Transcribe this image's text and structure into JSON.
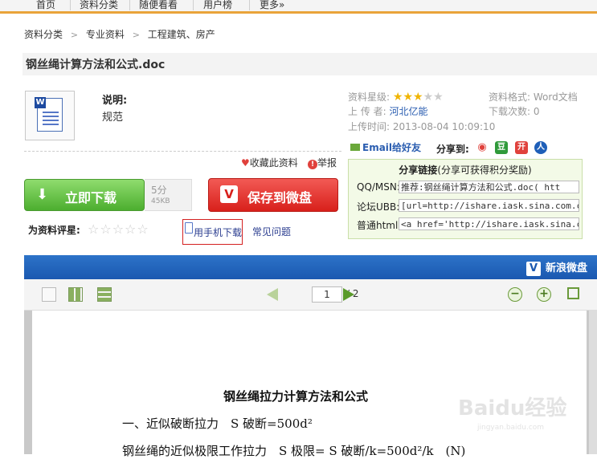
{
  "topnav": [
    "首页",
    "资料分类",
    "随便看看",
    "用户榜",
    "更多»"
  ],
  "breadcrumb": [
    "资料分类",
    "专业资料",
    "工程建筑、房产"
  ],
  "doc": {
    "title": "钢丝绳计算方法和公式.doc",
    "desc_label": "说明:",
    "desc_value": "规范"
  },
  "info": {
    "rating_label": "资料星级:",
    "rating": 3,
    "max_rating": 5,
    "format_label": "资料格式:",
    "format_value": "Word文档",
    "uploader_label": "上 传 者:",
    "uploader_value": "河北亿能",
    "downloads_label": "下载次数:",
    "downloads_value": "0",
    "time_label": "上传时间:",
    "time_value": "2013-08-04 10:09:10"
  },
  "share": {
    "email": "Email给好友",
    "share_to": "分享到:",
    "icons": [
      "weibo-icon",
      "douban-icon",
      "kaixin-icon",
      "renren-icon"
    ],
    "box_title": "分享链接",
    "box_hint": "(分享可获得积分奖励)",
    "qq_label": "QQ/MSN:",
    "qq_value": "推荐:钢丝绳计算方法和公式.doc( htt",
    "ubb_label": "论坛UBB:",
    "ubb_value": "[url=http://ishare.iask.sina.com.c",
    "html_label": "普通html:",
    "html_value": "<a href='http://ishare.iask.sina.c"
  },
  "actions": {
    "favorite": "收藏此资料",
    "report": "举报",
    "download": "立即下载",
    "points": "5分",
    "size": "45KB",
    "save": "保存到微盘"
  },
  "rating_row": {
    "label": "为资料评星:",
    "mobile": "用手机下载",
    "faq": "常见问题"
  },
  "viewer": {
    "brand": "新浪微盘",
    "page": "1",
    "total": "/ 2",
    "content_title": "钢丝绳拉力计算方法和公式",
    "line1": "一、近似破断拉力　S 破断=500d²",
    "line2": "钢丝绳的近似极限工作拉力　S 极限= S 破断/k=500d²/k　(N)"
  },
  "watermark": {
    "brand": "Baidu经验",
    "url": "jingyan.baidu.com"
  },
  "colors": {
    "accent_orange": "#e9a43a",
    "download_green": "#4cae2f",
    "save_red": "#d8201b",
    "viewer_blue": "#1a58b0"
  }
}
